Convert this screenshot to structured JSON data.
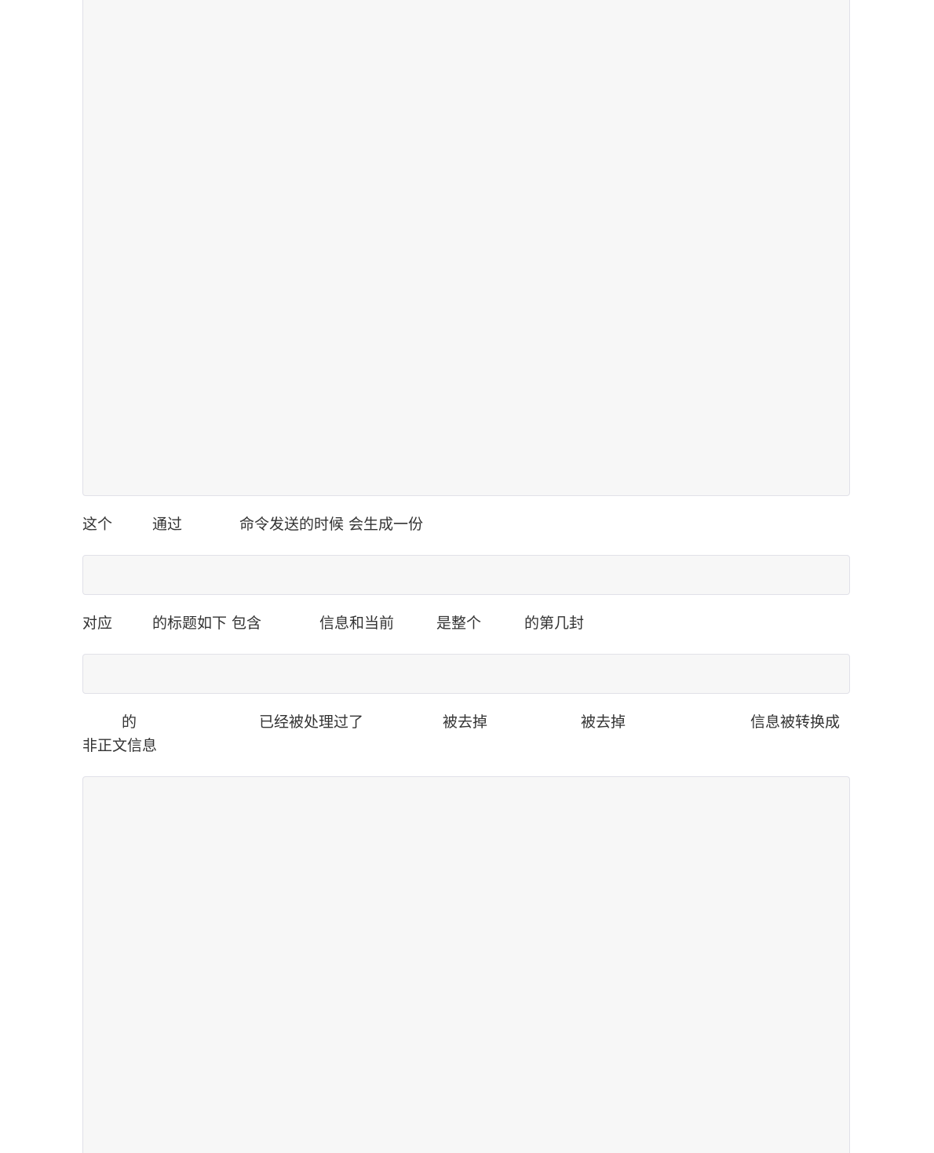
{
  "paragraphs": {
    "p1": [
      "这个",
      "通过",
      "命令发送的时候 会生成一份"
    ],
    "p2": [
      "对应",
      "的标题如下  包含",
      "信息和当前",
      "是整个",
      "的第几封"
    ],
    "p3": [
      "的",
      "已经被处理过了",
      "被去掉",
      "被去掉",
      "信息被转换成",
      "非正文信息"
    ]
  }
}
